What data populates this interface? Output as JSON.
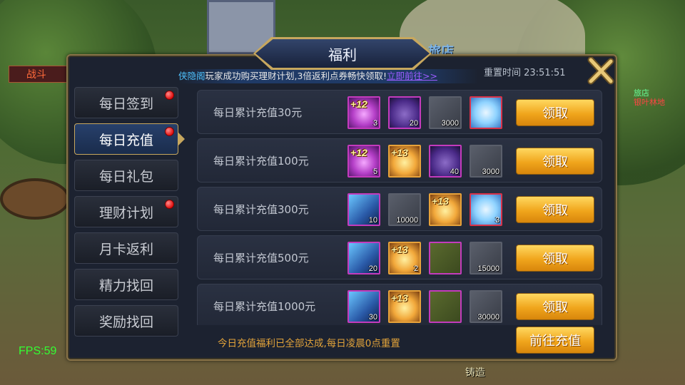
{
  "dialog": {
    "title": "福利",
    "reset_time": "重置时间 23:51:51",
    "marquee": {
      "tag": "侠隐阁",
      "text": "玩家成功购买理财计划,3倍返利点券畅快领取!",
      "link": "立即前往>>"
    },
    "footer_note": "今日充值福利已全部达成,每日凌晨0点重置",
    "recharge_button": "前往充值"
  },
  "sidebar": {
    "items": [
      {
        "label": "每日签到",
        "badge": true,
        "active": false
      },
      {
        "label": "每日充值",
        "badge": true,
        "active": true
      },
      {
        "label": "每日礼包",
        "badge": false,
        "active": false
      },
      {
        "label": "理财计划",
        "badge": true,
        "active": false
      },
      {
        "label": "月卡返利",
        "badge": false,
        "active": false
      },
      {
        "label": "精力找回",
        "badge": false,
        "active": false
      },
      {
        "label": "奖励找回",
        "badge": false,
        "active": false
      }
    ]
  },
  "rows": [
    {
      "label": "每日累计充值30元",
      "button": "领取",
      "items": [
        {
          "icon": "pink-enhance-icon",
          "plus": "+12",
          "qty": "3"
        },
        {
          "icon": "purple-box-icon",
          "plus": "",
          "qty": "20"
        },
        {
          "icon": "scroll-icon",
          "plus": "",
          "qty": "3000"
        },
        {
          "icon": "ice-crystal-icon",
          "plus": "",
          "qty": ""
        }
      ]
    },
    {
      "label": "每日累计充值100元",
      "button": "领取",
      "items": [
        {
          "icon": "pink-enhance-icon",
          "plus": "+12",
          "qty": "5"
        },
        {
          "icon": "gold-enhance-icon",
          "plus": "+13",
          "qty": ""
        },
        {
          "icon": "purple-box-icon",
          "plus": "",
          "qty": "40"
        },
        {
          "icon": "scroll-icon",
          "plus": "",
          "qty": "3000"
        }
      ]
    },
    {
      "label": "每日累计充值300元",
      "button": "领取",
      "items": [
        {
          "icon": "blade-icon",
          "plus": "",
          "qty": "10"
        },
        {
          "icon": "scroll-icon",
          "plus": "",
          "qty": "10000"
        },
        {
          "icon": "gold-enhance-icon",
          "plus": "+13",
          "qty": ""
        },
        {
          "icon": "ice-crystal-icon",
          "plus": "",
          "qty": "3"
        }
      ]
    },
    {
      "label": "每日累计充值500元",
      "button": "领取",
      "items": [
        {
          "icon": "blade-icon",
          "plus": "",
          "qty": "20"
        },
        {
          "icon": "gold-enhance-icon",
          "plus": "+13",
          "qty": "2"
        },
        {
          "icon": "card-icon",
          "plus": "",
          "qty": ""
        },
        {
          "icon": "scroll-icon",
          "plus": "",
          "qty": "15000"
        }
      ]
    },
    {
      "label": "每日累计充值1000元",
      "button": "领取",
      "items": [
        {
          "icon": "blade-icon",
          "plus": "",
          "qty": "30"
        },
        {
          "icon": "gold-enhance-icon",
          "plus": "+13",
          "qty": ""
        },
        {
          "icon": "card-icon",
          "plus": "",
          "qty": ""
        },
        {
          "icon": "scroll-icon",
          "plus": "",
          "qty": "30000"
        }
      ]
    }
  ],
  "scene": {
    "shop_sign": "旅店",
    "forge_label": "铸造",
    "left_npc": "战斗",
    "right_npc_title": "旅店",
    "right_npc_name": "银叶林地",
    "fps": "FPS:59"
  },
  "colors": {
    "accent_gold": "#c7a75e",
    "button_gold": "#f0a51c",
    "badge_red": "#e01010",
    "fps_green": "#33ff33",
    "note_orange": "#e2a33a"
  }
}
